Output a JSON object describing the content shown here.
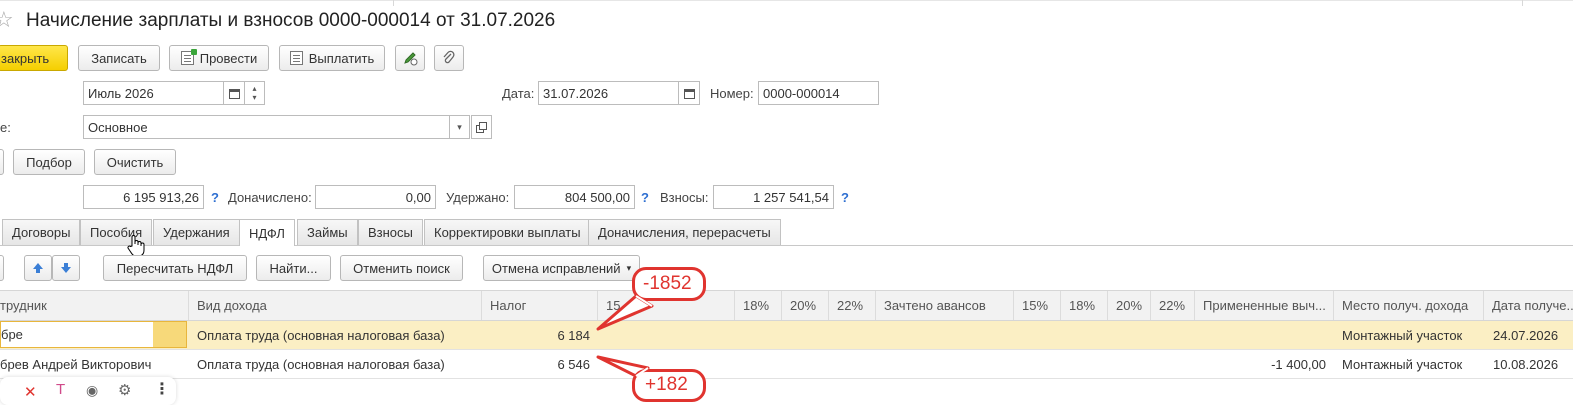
{
  "document": {
    "title": "Начисление зарплаты и взносов 0000-000014 от 31.07.2026"
  },
  "toolbar": {
    "close_label": "закрыть",
    "save_label": "Записать",
    "post_label": "Провести",
    "pay_label": "Выплатить"
  },
  "header": {
    "month_value": "Июль 2026",
    "date_label": "Дата:",
    "date_value": "31.07.2026",
    "number_label": "Номер:",
    "number_value": "0000-000014",
    "dept_label_fragment": "е:",
    "dept_value": "Основное"
  },
  "actions": {
    "select_label": "Подбор",
    "clear_label": "Очистить"
  },
  "totals": {
    "accrued_value": "6 195 913,26",
    "additional_label": "Доначислено:",
    "additional_value": "0,00",
    "withheld_label": "Удержано:",
    "withheld_value": "804 500,00",
    "contrib_label": "Взносы:",
    "contrib_value": "1 257 541,54",
    "help": "?"
  },
  "tabs": [
    {
      "label": "Договоры"
    },
    {
      "label": "Пособия"
    },
    {
      "label": "Удержания"
    },
    {
      "label": "НДФЛ",
      "active": true
    },
    {
      "label": "Займы"
    },
    {
      "label": "Взносы"
    },
    {
      "label": "Корректировки выплаты"
    },
    {
      "label": "Доначисления, перерасчеты"
    }
  ],
  "grid_toolbar": {
    "recalc_label": "Пересчитать НДФЛ",
    "find_label": "Найти...",
    "cancel_search_label": "Отменить поиск",
    "undo_fix_label": "Отмена исправлений"
  },
  "grid": {
    "columns": [
      "трудник",
      "Вид дохода",
      "Налог",
      "15",
      "18%",
      "20%",
      "22%",
      "Зачтено авансов",
      "15%",
      "18%",
      "20%",
      "22%",
      "Примененные выч...",
      "Место получ. дохода",
      "Дата получе..."
    ],
    "rows": [
      {
        "employee": "бре",
        "income_type": "Оплата труда (основная налоговая база)",
        "tax": "6 184",
        "deductions": "",
        "place": "Монтажный участок",
        "date": "24.07.2026"
      },
      {
        "employee": "брев Андрей Викторович",
        "income_type": "Оплата труда (основная налоговая база)",
        "tax": "6 546",
        "deductions": "-1 400,00",
        "place": "Монтажный участок",
        "date": "10.08.2026"
      }
    ]
  },
  "annotations": {
    "top": "-1852",
    "bottom": "+182",
    "color": "#e0342f"
  },
  "colors": {
    "accent_yellow": "#f5cf00",
    "selected_row": "#fbefc4",
    "help_blue": "#2e6fd1"
  }
}
